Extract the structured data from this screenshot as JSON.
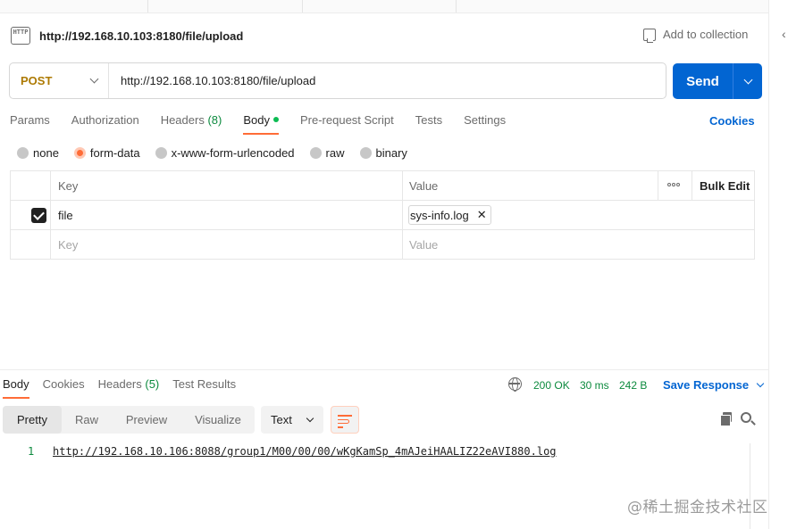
{
  "request": {
    "title": "http://192.168.10.103:8180/file/upload",
    "badge": "HTTP",
    "add_to_collection": "Add to collection",
    "method": "POST",
    "url": "http://192.168.10.103:8180/file/upload",
    "send_label": "Send"
  },
  "request_tabs": {
    "params": "Params",
    "authorization": "Authorization",
    "headers": "Headers",
    "headers_count": "(8)",
    "body": "Body",
    "prerequest": "Pre-request Script",
    "tests": "Tests",
    "settings": "Settings",
    "cookies": "Cookies"
  },
  "body_types": {
    "none": "none",
    "form_data": "form-data",
    "urlencoded": "x-www-form-urlencoded",
    "raw": "raw",
    "binary": "binary",
    "selected": "form-data"
  },
  "params_table": {
    "key_header": "Key",
    "value_header": "Value",
    "bulk_edit": "Bulk Edit",
    "rows": [
      {
        "key": "file",
        "value": "sys-info.log",
        "checked": true
      }
    ],
    "key_placeholder": "Key",
    "value_placeholder": "Value"
  },
  "response": {
    "tabs": {
      "body": "Body",
      "cookies": "Cookies",
      "headers": "Headers",
      "headers_count": "(5)",
      "test_results": "Test Results"
    },
    "status": "200 OK",
    "time": "30 ms",
    "size": "242 B",
    "save_response": "Save Response",
    "views": {
      "pretty": "Pretty",
      "raw": "Raw",
      "preview": "Preview",
      "visualize": "Visualize"
    },
    "format": "Text",
    "lines": [
      {
        "num": "1",
        "text": "http://192.168.10.106:8088/group1/M00/00/00/wKgKamSp_4mAJeiHAALIZ22eAVI880.log"
      }
    ]
  },
  "watermark": "@稀土掘金技术社区",
  "colors": {
    "accent": "#ff6c37",
    "primary": "#0265d2",
    "method_post": "#ad7a03",
    "success": "#0c8a3e"
  }
}
